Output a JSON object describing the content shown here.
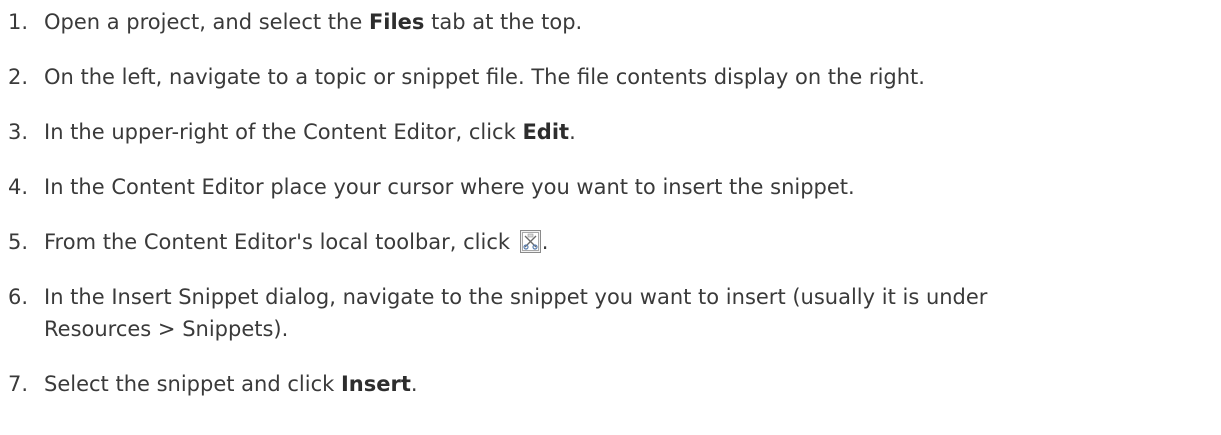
{
  "steps": [
    {
      "num": "1.",
      "pre": "Open a project, and select the ",
      "bold": "Files",
      "post": " tab at the top."
    },
    {
      "num": "2.",
      "text": "On the left, navigate to a topic or snippet file. The file contents display on the right."
    },
    {
      "num": "3.",
      "pre": "In the upper-right of the Content Editor, click ",
      "bold": "Edit",
      "post": "."
    },
    {
      "num": "4.",
      "text": "In the Content Editor place your cursor where you want to insert the snippet."
    },
    {
      "num": "5.",
      "pre": "From the Content Editor's local toolbar, click ",
      "icon": "insert-snippet-icon",
      "post": "."
    },
    {
      "num": "6.",
      "line1": "In the Insert Snippet dialog, navigate to the snippet you want to insert (usually it is under",
      "line2": "Resources > Snippets)."
    },
    {
      "num": "7.",
      "pre": "Select the snippet and click ",
      "bold": "Insert",
      "post": "."
    }
  ]
}
